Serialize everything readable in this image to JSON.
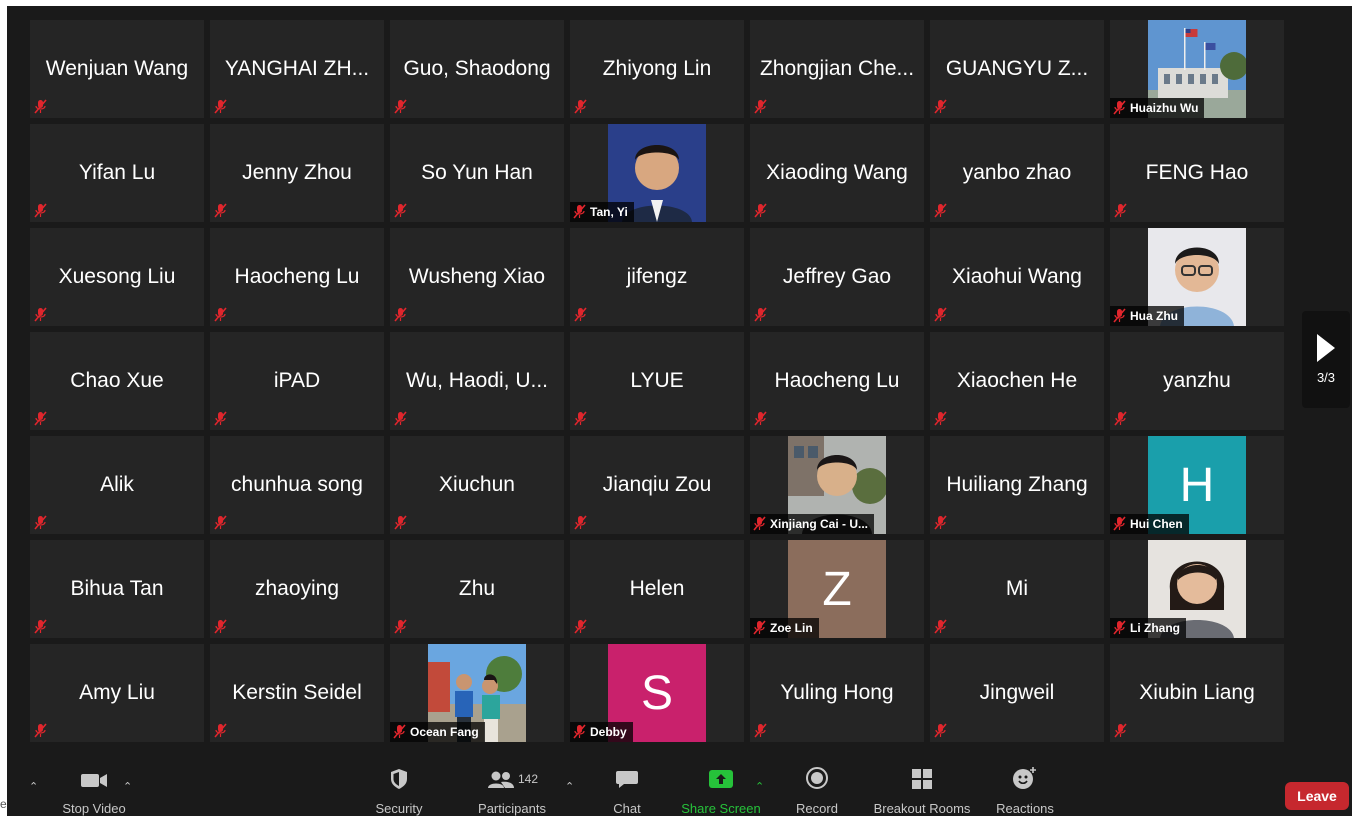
{
  "colors": {
    "background": "#1a1a1a",
    "tile": "#252525",
    "mute_red": "#e0262d",
    "share_green": "#26c23a",
    "leave_red": "#c6282e"
  },
  "tiles": [
    {
      "name": "Wenjuan Wang"
    },
    {
      "name": "YANGHAI ZH..."
    },
    {
      "name": "Guo, Shaodong"
    },
    {
      "name": "Zhiyong Lin"
    },
    {
      "name": "Zhongjian Che..."
    },
    {
      "name": "GUANGYU Z..."
    },
    {
      "label": "Huaizhu Wu",
      "pic": "building"
    },
    {
      "name": "Yifan Lu"
    },
    {
      "name": "Jenny Zhou"
    },
    {
      "name": "So Yun Han"
    },
    {
      "label": "Tan, Yi",
      "pic": "man-blue"
    },
    {
      "name": "Xiaoding Wang"
    },
    {
      "name": "yanbo zhao"
    },
    {
      "name": "FENG Hao"
    },
    {
      "name": "Xuesong Liu"
    },
    {
      "name": "Haocheng Lu"
    },
    {
      "name": "Wusheng Xiao"
    },
    {
      "name": "jifengz"
    },
    {
      "name": "Jeffrey Gao"
    },
    {
      "name": "Xiaohui Wang"
    },
    {
      "label": "Hua Zhu",
      "pic": "man-glasses"
    },
    {
      "name": "Chao Xue"
    },
    {
      "name": "iPAD"
    },
    {
      "name": "Wu, Haodi, U..."
    },
    {
      "name": "LYUE"
    },
    {
      "name": "Haocheng Lu"
    },
    {
      "name": "Xiaochen He"
    },
    {
      "name": "yanzhu"
    },
    {
      "name": "Alik"
    },
    {
      "name": "chunhua song"
    },
    {
      "name": "Xiuchun"
    },
    {
      "name": "Jianqiu Zou"
    },
    {
      "label": "Xinjiang Cai - U...",
      "pic": "man-outdoor"
    },
    {
      "name": "Huiliang Zhang"
    },
    {
      "label": "Hui Chen",
      "letter": "H",
      "letter_color": "#1a9fab"
    },
    {
      "name": "Bihua Tan"
    },
    {
      "name": "zhaoying"
    },
    {
      "name": "Zhu"
    },
    {
      "name": "Helen"
    },
    {
      "label": "Zoe Lin",
      "letter": "Z",
      "letter_color": "#8b6d5c"
    },
    {
      "name": "Mi"
    },
    {
      "label": "Li Zhang",
      "pic": "woman"
    },
    {
      "name": "Amy Liu"
    },
    {
      "name": "Kerstin Seidel"
    },
    {
      "label": "Ocean Fang",
      "pic": "couple"
    },
    {
      "label": "Debby",
      "letter": "S",
      "letter_color": "#c9216c"
    },
    {
      "name": "Yuling Hong"
    },
    {
      "name": "Jingweil"
    },
    {
      "name": "Xiubin Liang"
    }
  ],
  "pager": {
    "label": "3/3"
  },
  "toolbar": {
    "stop_video": "Stop Video",
    "security": "Security",
    "participants": "Participants",
    "participant_count": "142",
    "chat": "Chat",
    "share_screen": "Share Screen",
    "record": "Record",
    "breakout_rooms": "Breakout Rooms",
    "reactions": "Reactions",
    "leave": "Leave"
  },
  "edge_text": "e"
}
